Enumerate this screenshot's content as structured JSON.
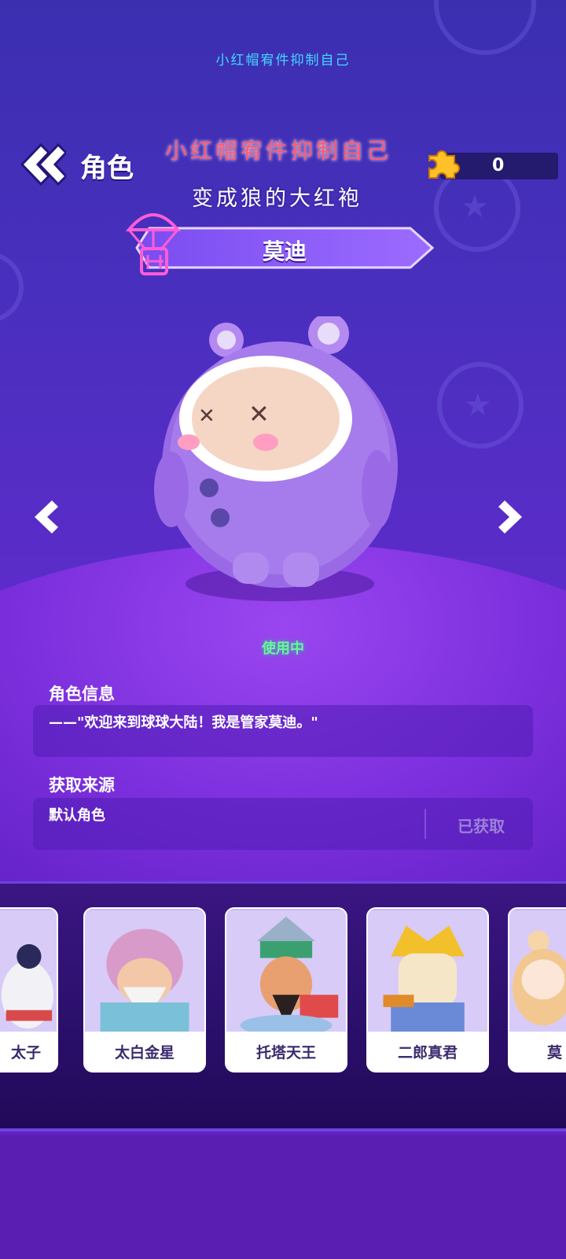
{
  "header": {
    "top_caption": "小红帽宥件抑制自己",
    "title": "角色",
    "overlay_line1": "小红帽宥件抑制自己",
    "overlay_line2": "变成狼的大红袍",
    "puzzle_count": "0"
  },
  "character": {
    "name": "莫迪",
    "status": "使用中"
  },
  "info": {
    "section_title": "角色信息",
    "quote": "——\"欢迎来到球球大陆！我是管家莫迪。\""
  },
  "source": {
    "section_title": "获取来源",
    "value": "默认角色",
    "status": "已获取"
  },
  "carousel": {
    "cards": [
      {
        "label": "太子"
      },
      {
        "label": "太白金星"
      },
      {
        "label": "托塔天王"
      },
      {
        "label": "二郎真君"
      },
      {
        "label": "莫"
      }
    ]
  },
  "colors": {
    "accent_green": "#6ff0a2",
    "caption_cyan": "#41d8ff",
    "overlay_red": "#ff5a6e",
    "panel": "#50209a"
  },
  "icons": [
    "back-double-chevron-icon",
    "puzzle-piece-icon",
    "parachute-crate-icon",
    "chevron-left-icon",
    "chevron-right-icon"
  ]
}
